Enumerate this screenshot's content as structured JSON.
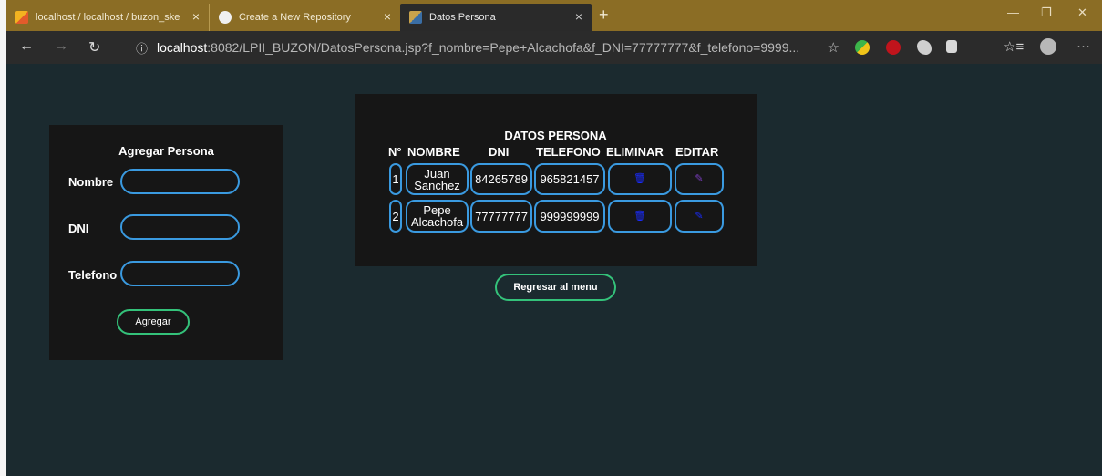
{
  "browser": {
    "tabs": [
      {
        "label": "localhost / localhost / buzon_ske",
        "close": "×"
      },
      {
        "label": "Create a New Repository",
        "close": "×"
      },
      {
        "label": "Datos Persona",
        "close": "×"
      }
    ],
    "new_tab": "+",
    "window_controls": {
      "minimize": "—",
      "restore": "❐",
      "close": "✕"
    },
    "nav": {
      "back": "←",
      "forward": "→",
      "reload": "↻"
    },
    "address": {
      "info_glyph": "ⓘ",
      "host": "localhost",
      "path": ":8082/LPII_BUZON/DatosPersona.jsp?f_nombre=Pepe+Alcachofa&f_DNI=77777777&f_telefono=9999...",
      "star": "☆"
    },
    "toolbar_glyphs": {
      "favorites": "☆≡",
      "more": "···"
    },
    "icons": [
      "page-info-icon",
      "star-icon",
      "extension-icon",
      "ublock-icon",
      "profile-icon"
    ]
  },
  "form": {
    "title": "Agregar Persona",
    "fields": [
      {
        "label": "Nombre",
        "value": "",
        "placeholder": ""
      },
      {
        "label": "DNI",
        "value": "",
        "placeholder": ""
      },
      {
        "label": "Telefono",
        "value": "",
        "placeholder": ""
      }
    ],
    "submit_label": "Agregar"
  },
  "table": {
    "title": "DATOS PERSONA",
    "headers": [
      "N°",
      "NOMBRE",
      "DNI",
      "TELEFONO",
      "ELIMINAR",
      "EDITAR"
    ],
    "rows": [
      {
        "num": "1",
        "nombre_1": "Juan",
        "nombre_2": "Sanchez",
        "dni": "84265789",
        "telefono": "965821457"
      },
      {
        "num": "2",
        "nombre_1": "Pepe",
        "nombre_2": "Alcachofa",
        "dni": "77777777",
        "telefono": "999999999"
      }
    ],
    "delete_icon": "🗑",
    "edit_icon": "✎"
  },
  "back_button": "Regresar al menu",
  "colors": {
    "page_bg": "#1b2a2f",
    "panel_bg": "#161616",
    "input_border": "#3a9ae0",
    "button_border": "#34c27a",
    "tabstrip_bg": "#8b6d25"
  }
}
